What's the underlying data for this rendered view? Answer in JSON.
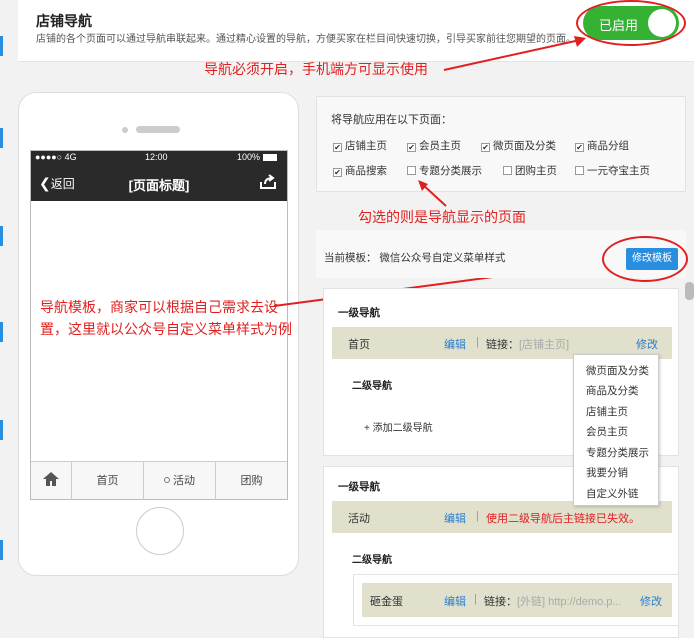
{
  "header": {
    "title": "店铺导航",
    "description": "店铺的各个页面可以通过导航串联起来。通过精心设置的导航，方便买家在栏目间快速切换，引导买家前往您期望的页面。",
    "toggle_label": "已启用"
  },
  "annotations": {
    "toggle_note": "导航必须开启，手机端方可显示使用",
    "checkbox_note": "勾选的则是导航显示的页面",
    "template_note": "导航模板，商家可以根据自己需求去设置，这里就以公众号自定义菜单样式为例"
  },
  "phone": {
    "signal": "●●●●○ 4G",
    "time": "12:00",
    "battery": "100%",
    "back_label": "返回",
    "page_title": "[页面标题]",
    "tabs": [
      "首页",
      "活动",
      "团购"
    ]
  },
  "apply": {
    "heading": "将导航应用在以下页面：",
    "options": [
      {
        "label": "店铺主页",
        "checked": true
      },
      {
        "label": "会员主页",
        "checked": true
      },
      {
        "label": "微页面及分类",
        "checked": true
      },
      {
        "label": "商品分组",
        "checked": true
      },
      {
        "label": "商品搜索",
        "checked": true
      },
      {
        "label": "专题分类展示",
        "checked": false
      },
      {
        "label": "团购主页",
        "checked": false
      },
      {
        "label": "一元夺宝主页",
        "checked": false
      }
    ]
  },
  "template": {
    "label": "当前模板：",
    "name": "微信公众号自定义菜单样式",
    "edit_button": "修改模板"
  },
  "nav_groups": [
    {
      "level1_title": "一级导航",
      "name": "首页",
      "edit": "编辑",
      "link_label": "链接：",
      "link_value": "[店铺主页]",
      "modify": "修改",
      "level2_title": "二级导航",
      "add_level2": "+ 添加二级导航"
    },
    {
      "level1_title": "一级导航",
      "name": "活动",
      "edit": "编辑",
      "notice": "使用二级导航后主链接已失效。",
      "level2_title": "二级导航",
      "sub": {
        "name": "砸金蛋",
        "edit": "编辑",
        "link_label": "链接：",
        "link_value": "[外链] http://demo.p...",
        "modify": "修改"
      }
    }
  ],
  "dropdown": {
    "items": [
      "微页面及分类",
      "商品及分类",
      "店铺主页",
      "会员主页",
      "专题分类展示",
      "我要分销",
      "自定义外链"
    ]
  },
  "colors": {
    "accent_blue": "#2a8ee0",
    "toggle_green": "#35b233",
    "annotation_red": "#e02020"
  }
}
